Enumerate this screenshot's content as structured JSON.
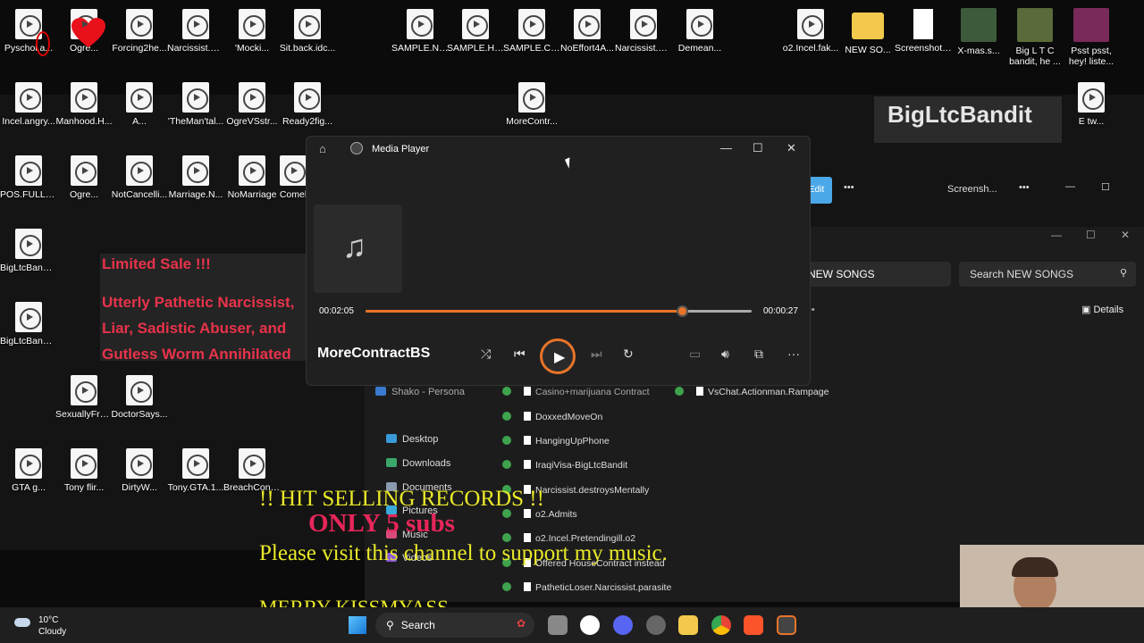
{
  "desktop": {
    "icons_row1": [
      "Pyschol.a...",
      "Ogre...",
      "Forcing2he...",
      "Narcissist.G...",
      "'Mocki...",
      "Sit.back.idc...",
      "SAMPLE.Na...",
      "SAMPLE.Hid...",
      "SAMPLE.Ca...",
      "NoEffort4A...",
      "Narcissist.Fi...",
      "Demean...",
      "o2.Incel.fak...",
      "NEW SO...",
      "Screenshot_...",
      "X-mas.s...",
      "Big L T C bandit, he ...",
      "Psst psst, hey! liste..."
    ],
    "icons_row2": [
      "Incel.angry...",
      "Manhood.H...",
      "A...",
      "'TheMan'tal...",
      "OgreVSstr...",
      "Ready2fig...",
      "MoreContr...",
      "E tw..."
    ],
    "icons_row3": [
      "POS.FULL.N...",
      "Ogre...",
      "NotCancelli...",
      "Marriage.N...",
      "NoMarriage",
      "Comel"
    ],
    "icons_col": [
      "BigLtcBandi...",
      "BigLtcBandi..."
    ],
    "icons_row5": [
      "SexuallyFru...",
      "DoctorSays..."
    ],
    "icons_row6": [
      "GTA g...",
      "Tony flir...",
      "DirtyW...",
      "Tony.GTA.1...",
      "BreachCont..."
    ]
  },
  "promo": {
    "title": "Limited Sale !!!",
    "line1": "Utterly Pathetic Narcissist,",
    "line2": "Liar, Sadistic Abuser, and",
    "line3": "Gutless Worm Annihilated"
  },
  "brand_box": "BigLtcBandit",
  "explorer": {
    "edit_label": "Edit",
    "other_title": "Screensh...",
    "address": "NEW SONGS",
    "search_placeholder": "Search NEW SONGS",
    "details_label": "Details",
    "nav": [
      "Shako - Persona",
      "Desktop",
      "Downloads",
      "Documents",
      "Pictures",
      "Music",
      "Videos"
    ],
    "files": [
      "Casino+marijuana Contract",
      "DoxxedMoveOn",
      "HangingUpPhone",
      "IraqiVisa-BigLtcBandit",
      "Narcissist.destroysMentally",
      "o2.Admits",
      "o2.Incel.Pretendingill.o2",
      "Offered HouseContract instead",
      "PatheticLoser.Narcissist.parasite"
    ],
    "files_col2": [
      "VsChat.Actionman.Rampage"
    ]
  },
  "player": {
    "title": "Media Player",
    "elapsed": "00:02:05",
    "remaining": "00:00:27",
    "progress": 0.82,
    "track": "MoreContractBS"
  },
  "overlay": {
    "line1": "!! HIT SELLING RECORDS !!",
    "line2": "ONLY 5 subs",
    "line3": "Please visit this channel to support my music.",
    "line4": "MERRY KISSMYASS"
  },
  "taskbar": {
    "temp": "10°C",
    "condition": "Cloudy",
    "search": "Search"
  },
  "colors": {
    "accent": "#e87428",
    "promo_red": "#e8334a",
    "overlay_yellow": "#e9e82a",
    "overlay_pink": "#e8265a"
  }
}
